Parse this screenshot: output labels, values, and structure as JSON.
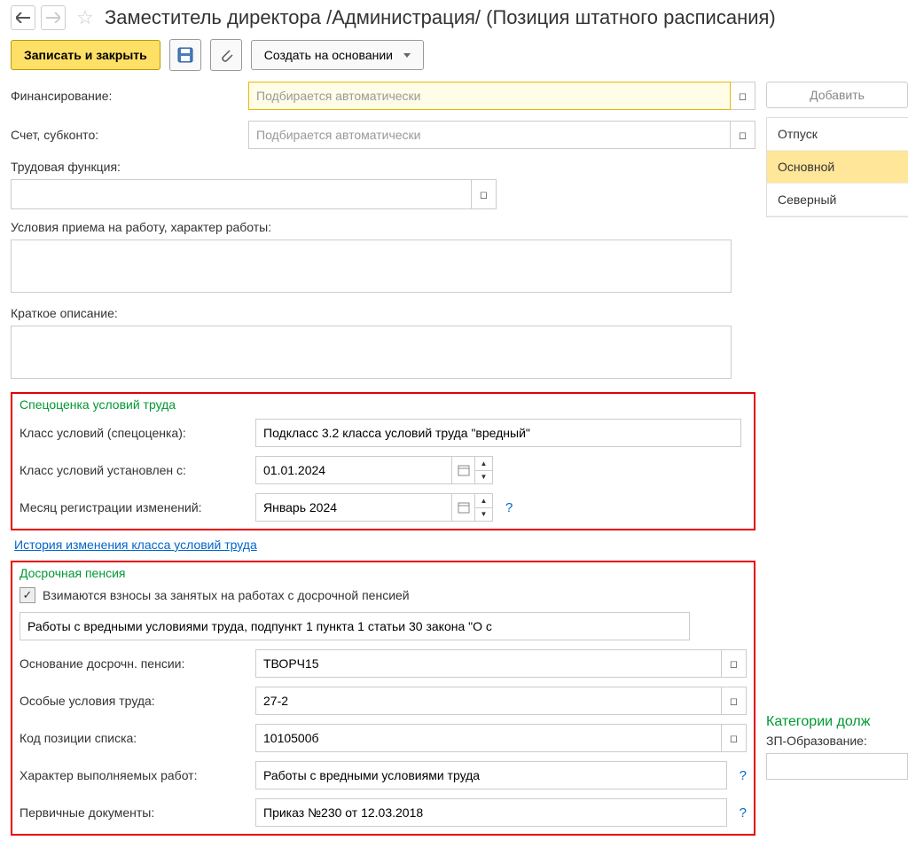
{
  "header": {
    "title": "Заместитель директора /Администрация/ (Позиция штатного расписания)"
  },
  "toolbar": {
    "save_close": "Записать и закрыть",
    "create_based": "Создать на основании"
  },
  "sidebar": {
    "add_btn": "Добавить",
    "items": [
      {
        "label": "Отпуск",
        "selected": false
      },
      {
        "label": "Основной",
        "selected": true
      },
      {
        "label": "Северный",
        "selected": false
      }
    ]
  },
  "form": {
    "financing_label": "Финансирование:",
    "financing_placeholder": "Подбирается автоматически",
    "account_label": "Счет, субконто:",
    "account_placeholder": "Подбирается автоматически",
    "labor_func_label": "Трудовая функция:",
    "labor_func_value": "",
    "cond_label": "Условия приема на работу, характер работы:",
    "cond_value": "",
    "short_desc_label": "Краткое описание:",
    "short_desc_value": ""
  },
  "spec": {
    "title": "Спецоценка условий труда",
    "class_label": "Класс условий (спецоценка):",
    "class_value": "Подкласс 3.2 класса условий труда \"вредный\"",
    "set_from_label": "Класс условий установлен с:",
    "set_from_value": "01.01.2024",
    "reg_month_label": "Месяц регистрации изменений:",
    "reg_month_value": "Январь 2024",
    "history_link": "История изменения класса условий труда"
  },
  "pension": {
    "title": "Досрочная пенсия",
    "check_label": "Взимаются взносы за занятых на работах с досрочной пенсией",
    "desc_value": "Работы с вредными условиями труда, подпункт 1 пункта 1 статьи 30 закона \"О с",
    "basis_label": "Основание досрочн. пенсии:",
    "basis_value": "ТВОРЧ15",
    "special_label": "Особые условия труда:",
    "special_value": "27-2",
    "pos_code_label": "Код позиции списка:",
    "pos_code_value": "1010500б",
    "char_label": "Характер выполняемых работ:",
    "char_value": "Работы с вредными условиями труда",
    "docs_label": "Первичные документы:",
    "docs_value": "Приказ №230 от 12.03.2018"
  },
  "bottom": {
    "cat_title": "Категории долж",
    "zp_label": "ЗП-Образование:"
  }
}
